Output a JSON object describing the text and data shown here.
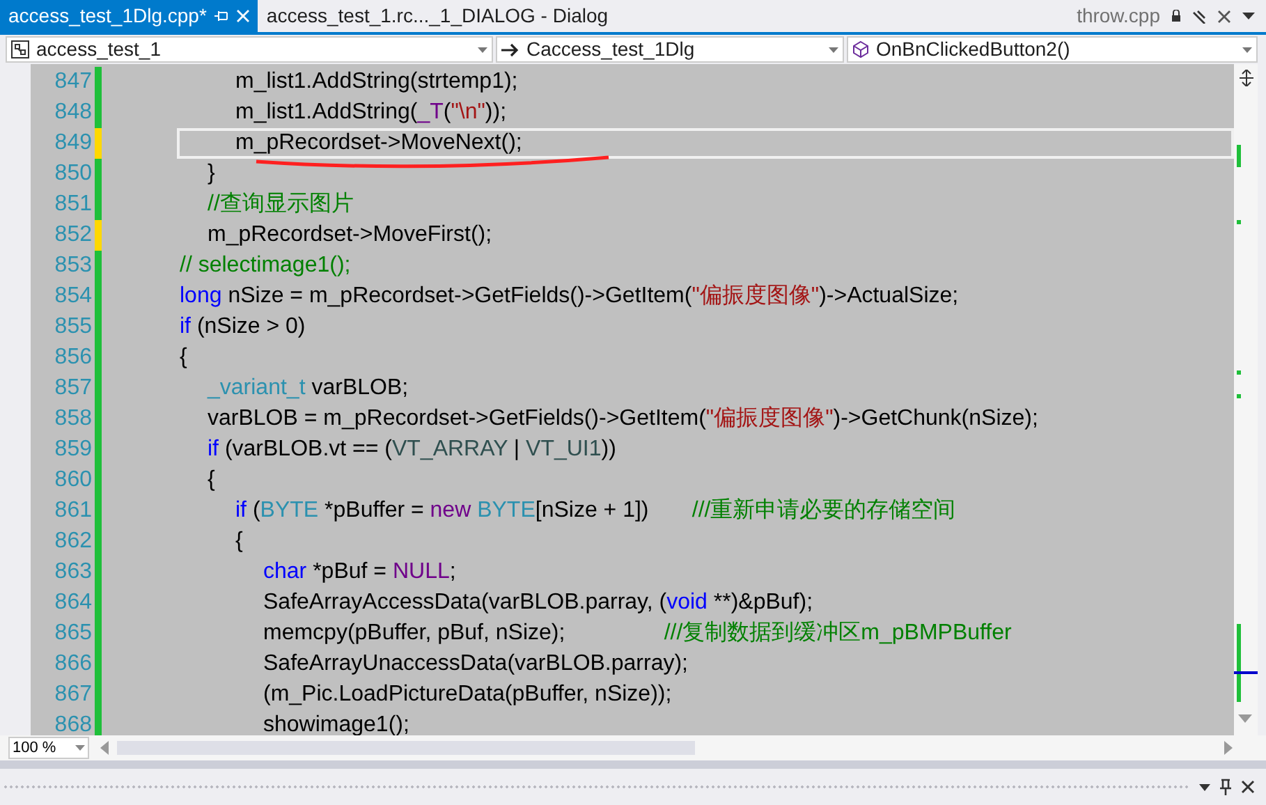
{
  "tabs": [
    {
      "label": "access_test_1Dlg.cpp*",
      "selected": true
    },
    {
      "label": "access_test_1.rc..._1_DIALOG - Dialog",
      "selected": false
    }
  ],
  "preview_tab": {
    "label": "throw.cpp"
  },
  "navigation_bar": [
    {
      "kind": "project",
      "value": "access_test_1"
    },
    {
      "kind": "class",
      "value": "Caccess_test_1Dlg"
    },
    {
      "kind": "method",
      "value": "OnBnClickedButton2()"
    }
  ],
  "code_lines": [
    {
      "number": "847",
      "saved": true,
      "current": false,
      "tokens": [
        {
          "kind": "plain",
          "text": "\t\tm_list1.AddString(strtemp1);"
        }
      ]
    },
    {
      "number": "848",
      "saved": true,
      "current": false,
      "tokens": [
        {
          "kind": "plain",
          "text": "\t\tm_list1.AddString("
        },
        {
          "kind": "macro",
          "text": "_T"
        },
        {
          "kind": "plain",
          "text": "("
        },
        {
          "kind": "string",
          "text": "\"\\n\""
        },
        {
          "kind": "plain",
          "text": "));"
        }
      ]
    },
    {
      "number": "849",
      "saved": false,
      "current": true,
      "tokens": [
        {
          "kind": "plain",
          "text": "\t\tm_pRecordset->MoveNext();"
        }
      ]
    },
    {
      "number": "850",
      "saved": true,
      "current": false,
      "tokens": [
        {
          "kind": "plain",
          "text": "\t}"
        }
      ]
    },
    {
      "number": "851",
      "saved": true,
      "current": false,
      "tokens": [
        {
          "kind": "comment",
          "text": "\t//查询显示图片"
        }
      ]
    },
    {
      "number": "852",
      "saved": false,
      "current": false,
      "tokens": [
        {
          "kind": "plain",
          "text": "\tm_pRecordset->MoveFirst();"
        }
      ]
    },
    {
      "number": "853",
      "saved": true,
      "current": false,
      "tokens": [
        {
          "kind": "comment",
          "text": "// selectimage1();"
        }
      ]
    },
    {
      "number": "854",
      "saved": true,
      "current": false,
      "tokens": [
        {
          "kind": "keyword",
          "text": "long"
        },
        {
          "kind": "plain",
          "text": " nSize = m_pRecordset->GetFields()->GetItem("
        },
        {
          "kind": "string",
          "text": "\"偏振度图像\""
        },
        {
          "kind": "plain",
          "text": ")->ActualSize;"
        }
      ]
    },
    {
      "number": "855",
      "saved": true,
      "current": false,
      "tokens": [
        {
          "kind": "keyword",
          "text": "if"
        },
        {
          "kind": "plain",
          "text": " (nSize > 0)"
        }
      ]
    },
    {
      "number": "856",
      "saved": true,
      "current": false,
      "tokens": [
        {
          "kind": "plain",
          "text": "{"
        }
      ]
    },
    {
      "number": "857",
      "saved": true,
      "current": false,
      "tokens": [
        {
          "kind": "type",
          "text": "\t_variant_t"
        },
        {
          "kind": "plain",
          "text": " varBLOB;"
        }
      ]
    },
    {
      "number": "858",
      "saved": true,
      "current": false,
      "tokens": [
        {
          "kind": "plain",
          "text": "\tvarBLOB = m_pRecordset->GetFields()->GetItem("
        },
        {
          "kind": "string",
          "text": "\"偏振度图像\""
        },
        {
          "kind": "plain",
          "text": ")->GetChunk(nSize);"
        }
      ]
    },
    {
      "number": "859",
      "saved": true,
      "current": false,
      "tokens": [
        {
          "kind": "keyword",
          "text": "\tif"
        },
        {
          "kind": "plain",
          "text": " (varBLOB.vt == ("
        },
        {
          "kind": "enum",
          "text": "VT_ARRAY"
        },
        {
          "kind": "plain",
          "text": " | "
        },
        {
          "kind": "enum",
          "text": "VT_UI1"
        },
        {
          "kind": "plain",
          "text": "))"
        }
      ]
    },
    {
      "number": "860",
      "saved": true,
      "current": false,
      "tokens": [
        {
          "kind": "plain",
          "text": "\t{"
        }
      ]
    },
    {
      "number": "861",
      "saved": true,
      "current": false,
      "tokens": [
        {
          "kind": "keyword",
          "text": "\t\tif"
        },
        {
          "kind": "plain",
          "text": " ("
        },
        {
          "kind": "type",
          "text": "BYTE"
        },
        {
          "kind": "plain",
          "text": " *pBuffer = "
        },
        {
          "kind": "macro",
          "text": "new"
        },
        {
          "kind": "type",
          "text": " BYTE"
        },
        {
          "kind": "plain",
          "text": "[nSize + 1])       "
        },
        {
          "kind": "comment",
          "text": "///重新申请必要的存储空间"
        }
      ]
    },
    {
      "number": "862",
      "saved": true,
      "current": false,
      "tokens": [
        {
          "kind": "plain",
          "text": "\t\t{"
        }
      ]
    },
    {
      "number": "863",
      "saved": true,
      "current": false,
      "tokens": [
        {
          "kind": "keyword",
          "text": "\t\t\tchar"
        },
        {
          "kind": "plain",
          "text": " *pBuf = "
        },
        {
          "kind": "macro",
          "text": "NULL"
        },
        {
          "kind": "plain",
          "text": ";"
        }
      ]
    },
    {
      "number": "864",
      "saved": true,
      "current": false,
      "tokens": [
        {
          "kind": "plain",
          "text": "\t\t\tSafeArrayAccessData(varBLOB.parray, ("
        },
        {
          "kind": "keyword",
          "text": "void"
        },
        {
          "kind": "plain",
          "text": " **)&pBuf);"
        }
      ]
    },
    {
      "number": "865",
      "saved": true,
      "current": false,
      "tokens": [
        {
          "kind": "plain",
          "text": "\t\t\tmemcpy(pBuffer, pBuf, nSize);                "
        },
        {
          "kind": "comment",
          "text": "///复制数据到缓冲区m_pBMPBuffer"
        }
      ]
    },
    {
      "number": "866",
      "saved": true,
      "current": false,
      "tokens": [
        {
          "kind": "plain",
          "text": "\t\t\tSafeArrayUnaccessData(varBLOB.parray);"
        }
      ]
    },
    {
      "number": "867",
      "saved": true,
      "current": false,
      "tokens": [
        {
          "kind": "plain",
          "text": "\t\t\t(m_Pic.LoadPictureData(pBuffer, nSize));"
        }
      ]
    },
    {
      "number": "868",
      "saved": true,
      "current": false,
      "tokens": [
        {
          "kind": "plain",
          "text": "\t\t\tshowimage1();"
        }
      ]
    }
  ],
  "zoom": {
    "value": "100 %"
  }
}
